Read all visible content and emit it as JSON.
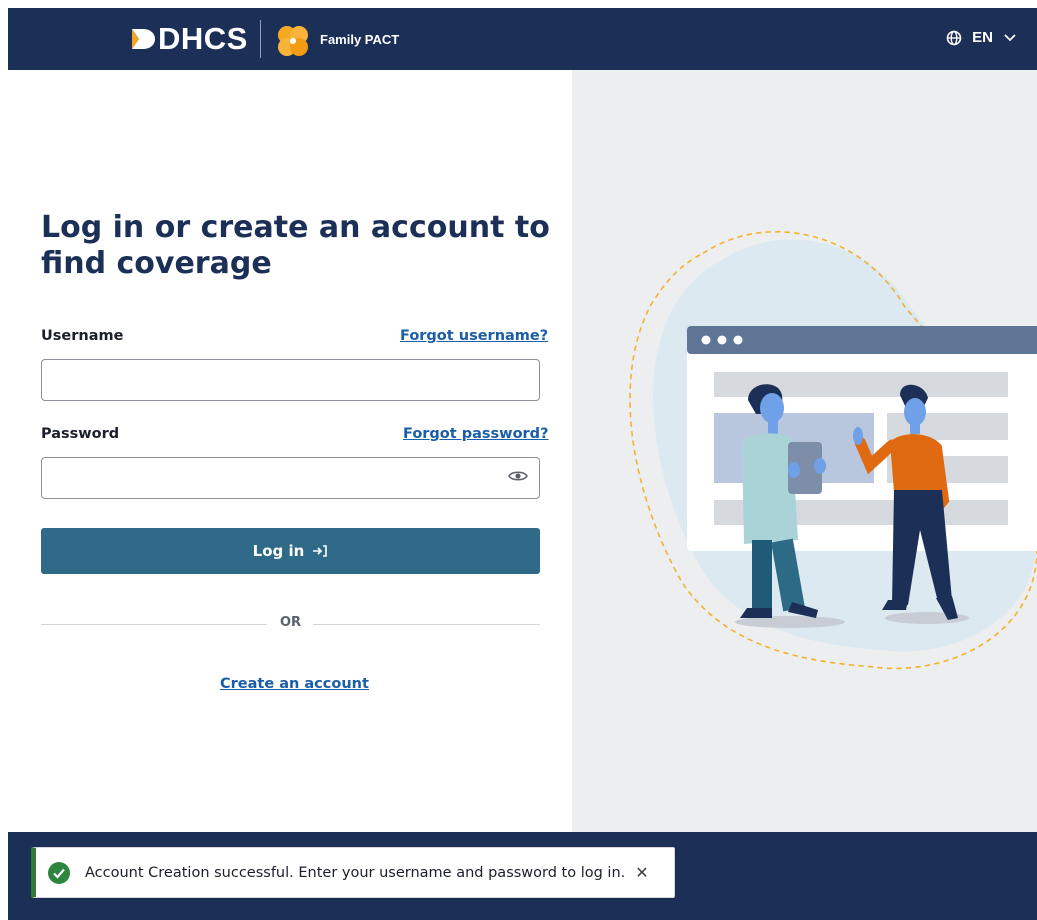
{
  "header": {
    "brand": "DHCS",
    "program": "Family PACT",
    "language": "EN"
  },
  "login": {
    "title": "Log in or create an account to find coverage",
    "username_label": "Username",
    "forgot_username": "Forgot username?",
    "username_value": "",
    "password_label": "Password",
    "forgot_password": "Forgot password?",
    "password_value": "",
    "login_button": "Log in",
    "or_text": "OR",
    "create_account": "Create an account"
  },
  "toast": {
    "message": "Account Creation successful. Enter your username and password to log in.",
    "close": "✕",
    "status_color": "#2e7d32"
  },
  "footer": {
    "logo_fragment": "D"
  },
  "colors": {
    "header_bg": "#1b2f57",
    "button_bg": "#2f6b89",
    "link": "#1b5ea8",
    "illustration_bg": "#edeef0"
  },
  "icons": [
    "globe-icon",
    "chevron-down-icon",
    "eye-icon",
    "login-arrow-icon",
    "check-circle-icon",
    "close-icon",
    "poppy-logo-icon"
  ]
}
